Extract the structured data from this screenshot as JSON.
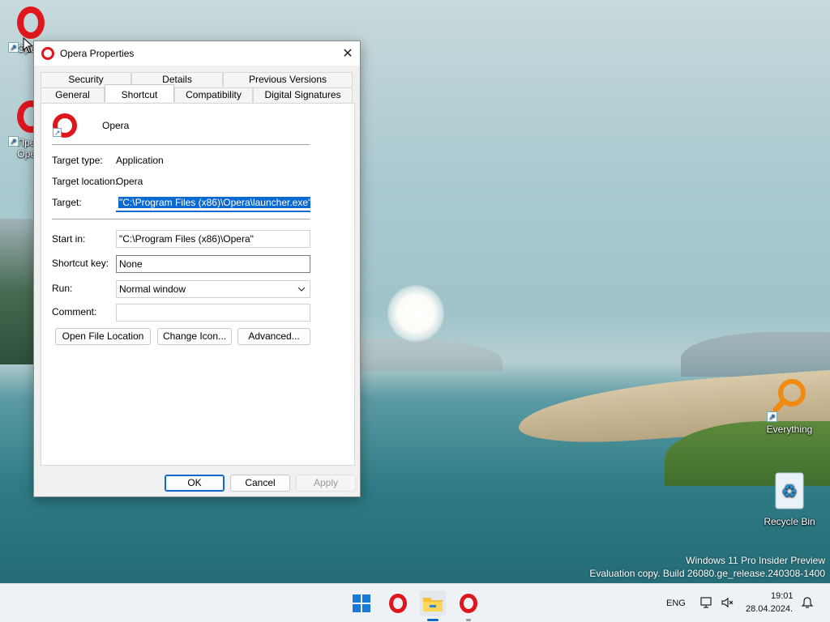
{
  "desktop": {
    "icons": [
      {
        "label": "Opera"
      },
      {
        "label": "Прегл Opera"
      },
      {
        "label": "Everything"
      },
      {
        "label": "Recycle Bin"
      }
    ],
    "watermark": {
      "line1": "Windows 11 Pro Insider Preview",
      "line2": "Evaluation copy. Build 26080.ge_release.240308-1400"
    }
  },
  "dialog": {
    "title": "Opera Properties",
    "close_glyph": "✕",
    "tabs_top": [
      "Security",
      "Details",
      "Previous Versions"
    ],
    "tabs_bottom": [
      "General",
      "Shortcut",
      "Compatibility",
      "Digital Signatures"
    ],
    "active_tab": "Shortcut",
    "app_name": "Opera",
    "target_type_label": "Target type:",
    "target_type_value": "Application",
    "target_location_label": "Target location:",
    "target_location_value": "Opera",
    "target_label": "Target:",
    "target_value": "\"C:\\Program Files (x86)\\Opera\\launcher.exe\"",
    "start_in_label": "Start in:",
    "start_in_value": "\"C:\\Program Files (x86)\\Opera\"",
    "shortcut_key_label": "Shortcut key:",
    "shortcut_key_value": "None",
    "run_label": "Run:",
    "run_value": "Normal window",
    "comment_label": "Comment:",
    "comment_value": "",
    "buttons": {
      "open_file_location": "Open File Location",
      "change_icon": "Change Icon...",
      "advanced": "Advanced...",
      "ok": "OK",
      "cancel": "Cancel",
      "apply": "Apply"
    }
  },
  "taskbar": {
    "language": "ENG",
    "time": "19:01",
    "date": "28.04.2024."
  },
  "colors": {
    "accent": "#0b69d1",
    "opera_red": "#e0161e"
  }
}
